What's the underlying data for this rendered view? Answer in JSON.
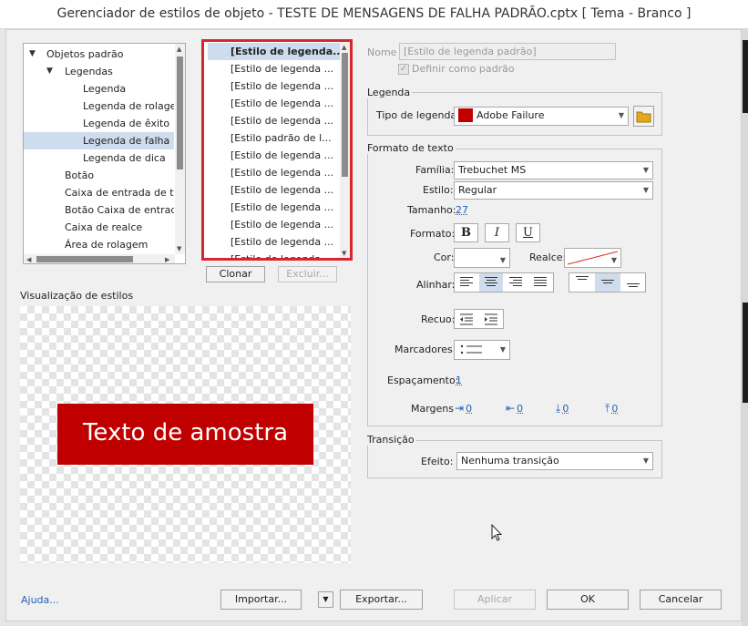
{
  "window": {
    "title": "Gerenciador de estilos de objeto - TESTE DE MENSAGENS DE FALHA PADRÃO.cptx [ Tema - Branco ]"
  },
  "tree": {
    "items": [
      {
        "label": "Objetos padrão",
        "level": 0,
        "expanded": true
      },
      {
        "label": "Legendas",
        "level": 1,
        "expanded": true
      },
      {
        "label": "Legenda",
        "level": 2
      },
      {
        "label": "Legenda de rolagem",
        "level": 2
      },
      {
        "label": "Legenda de êxito",
        "level": 2
      },
      {
        "label": "Legenda de falha",
        "level": 2,
        "selected": true
      },
      {
        "label": "Legenda de dica",
        "level": 2
      },
      {
        "label": "Botão",
        "level": 1
      },
      {
        "label": "Caixa de entrada de texto",
        "level": 1
      },
      {
        "label": "Botão Caixa de entrada",
        "level": 1
      },
      {
        "label": "Caixa de realce",
        "level": 1
      },
      {
        "label": "Área de rolagem",
        "level": 1
      }
    ]
  },
  "style_list": {
    "items": [
      "[Estilo de legenda...",
      "[Estilo de legenda ...",
      "[Estilo de legenda ...",
      "[Estilo de legenda ...",
      "[Estilo de legenda ...",
      "[Estilo padrão de l...",
      "[Estilo de legenda ...",
      "[Estilo de legenda ...",
      "[Estilo de legenda ...",
      "[Estilo de legenda ...",
      "[Estilo de legenda ...",
      "[Estilo de legenda ...",
      "[Estilo de legenda ..."
    ],
    "clone_label": "Clonar",
    "delete_label": "Excluir..."
  },
  "preview": {
    "title": "Visualização de estilos",
    "sample_text": "Texto de amostra",
    "sample_bg": "#c00000"
  },
  "name_section": {
    "label": "Nome",
    "value": "[Estilo de legenda padrão]",
    "default_label": "Definir como padrão",
    "default_checked": true
  },
  "caption": {
    "group_title": "Legenda",
    "type_label": "Tipo de legenda:",
    "type_value": "Adobe Failure",
    "type_color": "#c00000"
  },
  "text_format": {
    "group_title": "Formato de texto",
    "family_label": "Família:",
    "family_value": "Trebuchet MS",
    "style_label": "Estilo:",
    "style_value": "Regular",
    "size_label": "Tamanho:",
    "size_value": "27",
    "format_label": "Formato:",
    "bold": "B",
    "italic": "I",
    "underline": "U",
    "color_label": "Cor:",
    "highlight_label": "Realce:",
    "align_label": "Alinhar:",
    "indent_label": "Recuo:",
    "bullets_label": "Marcadores:",
    "spacing_label": "Espaçamento:",
    "spacing_value": "1",
    "margins_label": "Margens",
    "margins": [
      "0",
      "0",
      "0",
      "0"
    ]
  },
  "transition": {
    "group_title": "Transição",
    "effect_label": "Efeito:",
    "effect_value": "Nenhuma transição"
  },
  "footer": {
    "help": "Ajuda...",
    "import": "Importar...",
    "export": "Exportar...",
    "apply": "Aplicar",
    "ok": "OK",
    "cancel": "Cancelar"
  }
}
